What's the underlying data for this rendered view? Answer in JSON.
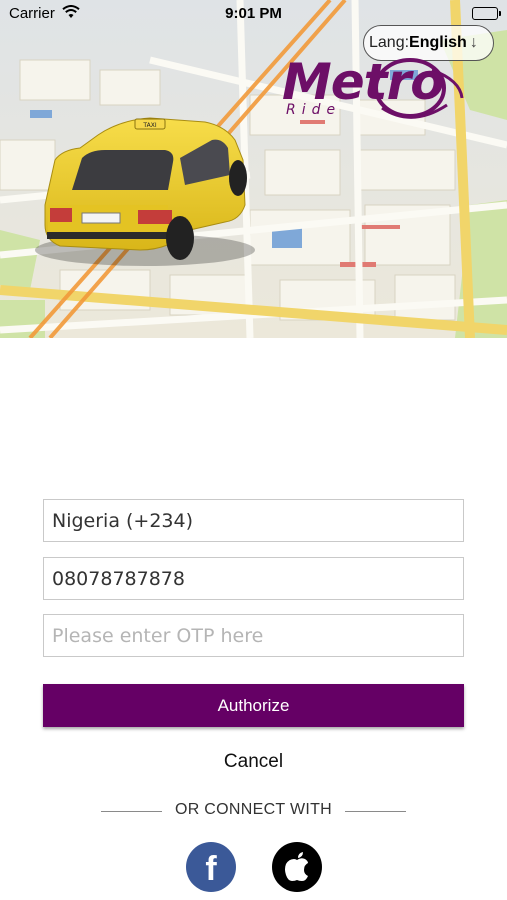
{
  "status_bar": {
    "carrier": "Carrier",
    "time": "9:01 PM"
  },
  "language": {
    "label": "Lang:",
    "value": "English",
    "arrow": "↓"
  },
  "logo": {
    "title": "Metro",
    "subtitle": "Ride",
    "color": "#6d0f67"
  },
  "form": {
    "country": "Nigeria (+234)",
    "phone": "08078787878",
    "otp_placeholder": "Please enter OTP here",
    "otp_value": ""
  },
  "buttons": {
    "authorize": "Authorize",
    "cancel": "Cancel"
  },
  "connect": {
    "label": "OR CONNECT WITH",
    "facebook_glyph": "f",
    "facebook_icon": "facebook-icon",
    "apple_icon": "apple-icon"
  },
  "colors": {
    "primary": "#650065",
    "facebook": "#3b5998",
    "taxi": "#f2cf27"
  }
}
